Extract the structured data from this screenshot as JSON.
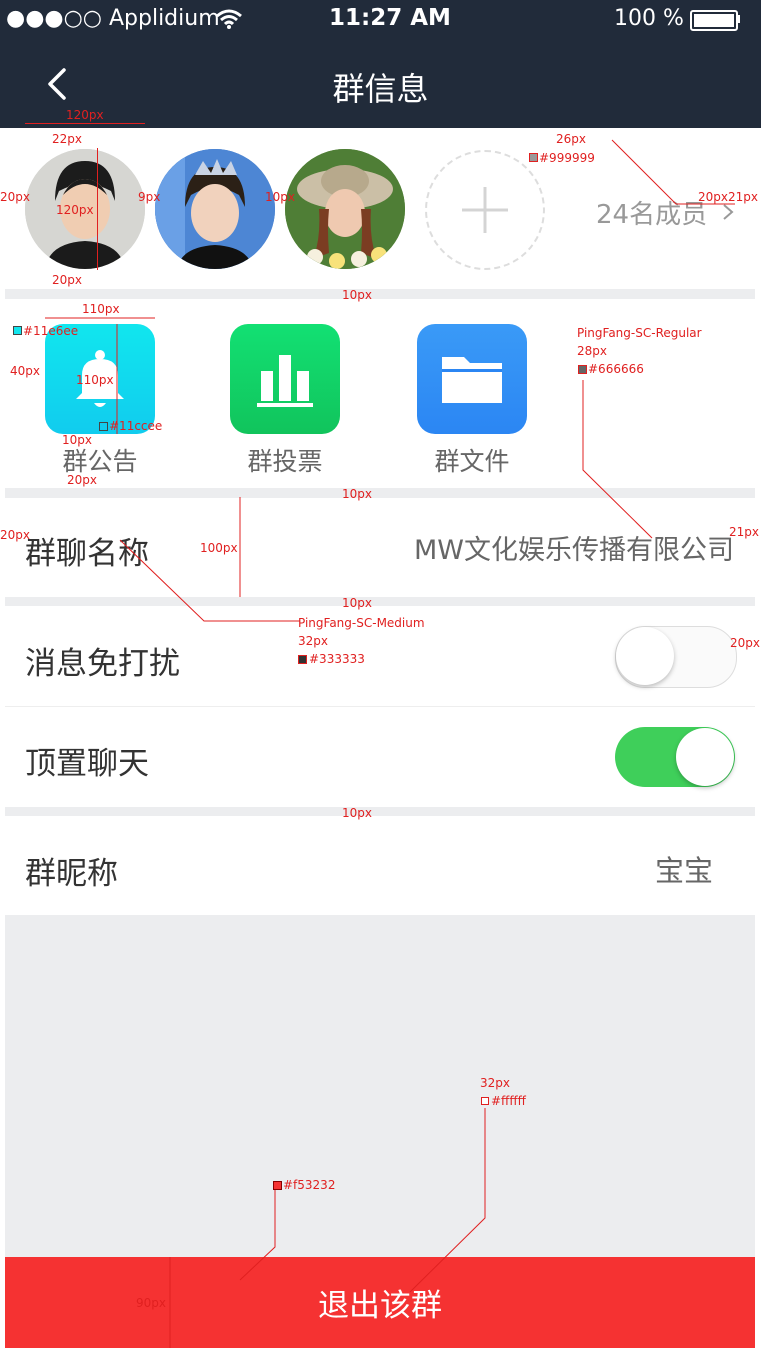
{
  "status_bar": {
    "carrier": "●●●○○ Applidium",
    "time": "11:27 AM",
    "battery": "100 %"
  },
  "nav": {
    "title": "群信息"
  },
  "members": {
    "count_label": "24名成员"
  },
  "features": [
    {
      "label": "群公告",
      "color": "#11e6ee",
      "icon": "bell-icon"
    },
    {
      "label": "群投票",
      "color": "#11cc66",
      "icon": "bar-chart-icon"
    },
    {
      "label": "群文件",
      "color": "#2f8ff5",
      "icon": "folder-icon"
    }
  ],
  "group_name": {
    "label": "群聊名称",
    "value": "MW文化娱乐传播有限公司"
  },
  "mute": {
    "label": "消息免打扰",
    "on": false
  },
  "pin": {
    "label": "顶置聊天",
    "on": true
  },
  "nickname": {
    "label": "群昵称",
    "value": "宝宝"
  },
  "exit_button": {
    "label": "退出该群",
    "color": "#f53232"
  },
  "annotations": {
    "a_120px": "120px",
    "a_22px": "22px",
    "a_26px": "26px",
    "a_999": "#999999",
    "a_20px_l": "20px",
    "a_120px_v": "120px",
    "a_9px": "9px",
    "a_10px_gap": "10px",
    "a_20px_r": "20px",
    "a_21px_r": "21px",
    "a_20px_b": "20px",
    "a_10px_1": "10px",
    "a_110px": "110px",
    "a_11e6ee": "#11e6ee",
    "a_40px": "40px",
    "a_110px_v": "110px",
    "a_10px_icon": "10px",
    "a_11ccee": "#11ccee",
    "a_20px_lbl": "20px",
    "a_font_regular": "PingFang-SC-Regular",
    "a_28px": "28px",
    "a_666": "#666666",
    "a_10px_2": "10px",
    "a_20px_name": "20px",
    "a_100px": "100px",
    "a_21px_name": "21px",
    "a_10px_3": "10px",
    "a_font_medium": "PingFang-SC-Medium",
    "a_32px": "32px",
    "a_333": "#333333",
    "a_20px_sw": "20px",
    "a_10px_4": "10px",
    "a_32px_btn": "32px",
    "a_fff": "#ffffff",
    "a_f53232": "#f53232",
    "a_90px": "90px"
  }
}
